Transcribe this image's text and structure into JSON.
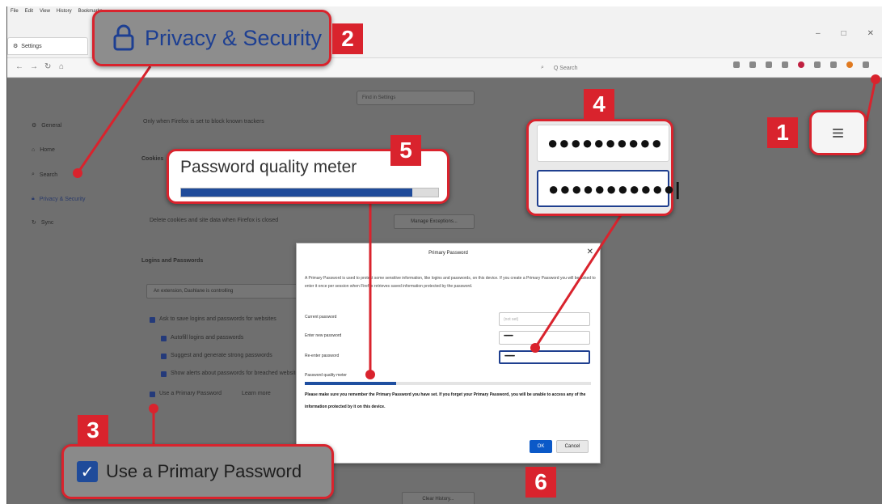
{
  "menubar": [
    "File",
    "Edit",
    "View",
    "History",
    "Bookmarks"
  ],
  "tab": {
    "title": "Settings"
  },
  "window_controls": [
    "–",
    "□",
    "✕"
  ],
  "navbar": {
    "search_placeholder": "Q Search"
  },
  "settings": {
    "search_placeholder": "Find in Settings",
    "sidebar": [
      {
        "label": "General",
        "icon": "gear-icon"
      },
      {
        "label": "Home",
        "icon": "home-icon"
      },
      {
        "label": "Search",
        "icon": "search-icon"
      },
      {
        "label": "Privacy & Security",
        "icon": "lock-icon",
        "active": true
      },
      {
        "label": "Sync",
        "icon": "sync-icon"
      }
    ],
    "ghost_text": {
      "only_when": "Only when Firefox is set to block known trackers",
      "cookies_heading": "Cookies",
      "delete_cookies": "Delete cookies and site data when Firefox is closed",
      "manage_exceptions": "Manage Exceptions...",
      "logins_heading": "Logins and Passwords",
      "extension_banner": "An extension, Dashlane is controlling",
      "ask_to_save": "Ask to save logins and passwords for websites",
      "autofill": "Autofill logins and passwords",
      "suggest": "Suggest and generate strong passwords",
      "alerts": "Show alerts about passwords for breached websites",
      "use_primary": "Use a Primary Password",
      "learn_more": "Learn more",
      "clear_history": "Clear History..."
    }
  },
  "dialog": {
    "title": "Primary Password",
    "description": "A Primary Password is used to protect some sensitive information, like logins and passwords, on this device. If you create a Primary Password you will be asked to enter it once per session when Firefox retrieves saved information protected by the password.",
    "current_label": "Current password",
    "current_value": "(not set)",
    "new_label": "Enter new password",
    "new_value": "••••••••••",
    "reenter_label": "Re-enter password",
    "reenter_value": "•••••••••••",
    "meter_label": "Password quality meter",
    "meter_level": 0.32,
    "warning": "Please make sure you remember the Primary Password you have set. If you forget your Primary Password, you will be unable to access any of the information protected by it on this device.",
    "ok_label": "OK",
    "cancel_label": "Cancel"
  },
  "callouts": {
    "privacy_label": "Privacy & Security",
    "menu_glyph": "≡",
    "pw_new": "●●●●●●●●●●",
    "pw_reenter": "●●●●●●●●●●●|",
    "meter_label": "Password quality meter",
    "meter_level": 0.9,
    "primary_label": "Use a Primary Password"
  },
  "badges": [
    "1",
    "2",
    "3",
    "4",
    "5",
    "6"
  ],
  "colors": {
    "accent_red": "#d9232d",
    "brand_blue": "#1f3f8f",
    "ok_blue": "#0b59c8"
  }
}
